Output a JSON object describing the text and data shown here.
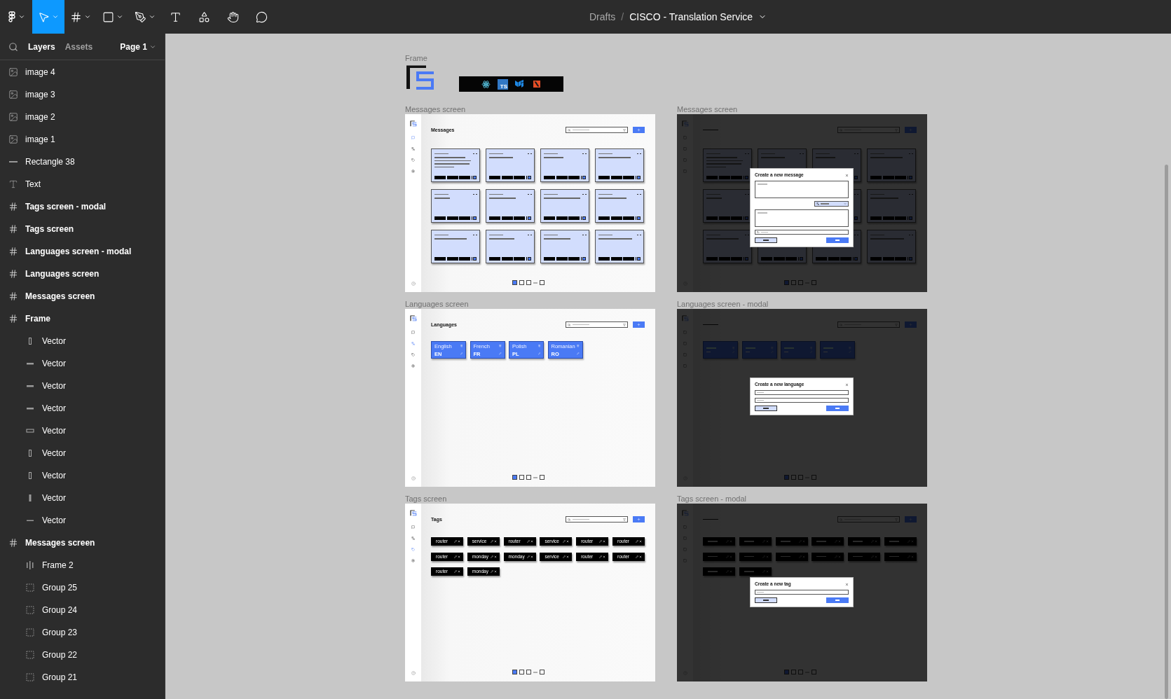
{
  "toolbar": {
    "tools": [
      {
        "kind": "main-menu",
        "selected": false
      },
      {
        "kind": "move",
        "selected": true
      },
      {
        "kind": "frame",
        "selected": false
      },
      {
        "kind": "shape",
        "selected": false
      },
      {
        "kind": "pen",
        "selected": false
      },
      {
        "kind": "text",
        "selected": false
      },
      {
        "kind": "resources",
        "selected": false
      },
      {
        "kind": "hand",
        "selected": false
      },
      {
        "kind": "comment",
        "selected": false
      }
    ]
  },
  "breadcrumb": {
    "folder": "Drafts",
    "separator": "/",
    "file": "CISCO - Translation Service"
  },
  "layers_panel": {
    "tabs": [
      {
        "label": "Layers",
        "selected": true
      },
      {
        "label": "Assets",
        "selected": false
      }
    ],
    "page": "Page 1",
    "items": [
      {
        "kind": "image",
        "name": "image 4"
      },
      {
        "kind": "image",
        "name": "image 3"
      },
      {
        "kind": "image",
        "name": "image 2"
      },
      {
        "kind": "image",
        "name": "image 1"
      },
      {
        "kind": "line",
        "name": "Rectangle 38"
      },
      {
        "kind": "text",
        "name": "Text"
      },
      {
        "kind": "frame",
        "name": "Tags screen - modal"
      },
      {
        "kind": "frame",
        "name": "Tags screen"
      },
      {
        "kind": "frame",
        "name": "Languages screen - modal"
      },
      {
        "kind": "frame",
        "name": "Languages screen"
      },
      {
        "kind": "frame",
        "name": "Messages screen"
      },
      {
        "kind": "frame",
        "name": "Frame",
        "children": [
          {
            "kind": "vector-vertical",
            "name": "Vector"
          },
          {
            "kind": "vector-horizontal",
            "name": "Vector"
          },
          {
            "kind": "vector-horizontal",
            "name": "Vector"
          },
          {
            "kind": "vector-horizontal",
            "name": "Vector"
          },
          {
            "kind": "vector-rect",
            "name": "Vector"
          },
          {
            "kind": "vector-vertical",
            "name": "Vector"
          },
          {
            "kind": "vector-vertical",
            "name": "Vector"
          },
          {
            "kind": "vector-bar",
            "name": "Vector"
          },
          {
            "kind": "vector-line",
            "name": "Vector"
          }
        ]
      },
      {
        "kind": "frame",
        "name": "Messages screen",
        "children": [
          {
            "kind": "columns",
            "name": "Frame 2"
          },
          {
            "kind": "group",
            "name": "Group 25"
          },
          {
            "kind": "group",
            "name": "Group 24"
          },
          {
            "kind": "group",
            "name": "Group 23"
          },
          {
            "kind": "group",
            "name": "Group 22"
          },
          {
            "kind": "group",
            "name": "Group 21"
          }
        ]
      }
    ]
  },
  "canvas": {
    "frame_label": "Frame",
    "banner_badge": "TS",
    "screens": [
      {
        "label": "Messages screen",
        "kind": "messages",
        "title": "Messages",
        "nav": [
          {
            "kind": "messages",
            "selected": true
          },
          {
            "kind": "languages",
            "selected": false
          },
          {
            "kind": "tags",
            "selected": false
          },
          {
            "kind": "settings",
            "selected": false
          }
        ],
        "pages": [
          {
            "kind": "page",
            "selected": true
          },
          {
            "kind": "page",
            "selected": false
          },
          {
            "kind": "page",
            "selected": false
          },
          {
            "kind": "ellipsis"
          },
          {
            "kind": "page",
            "selected": false
          }
        ]
      },
      {
        "label": "Messages screen",
        "kind": "messages",
        "modal": {
          "kind": "message",
          "title": "Create a new message",
          "fields": [
            {
              "kind": "textarea"
            },
            {
              "kind": "select"
            },
            {
              "kind": "textarea"
            },
            {
              "kind": "tags"
            }
          ]
        }
      },
      {
        "label": "Languages screen",
        "kind": "languages",
        "title": "Languages",
        "nav": [
          {
            "kind": "messages",
            "selected": false
          },
          {
            "kind": "languages",
            "selected": true
          },
          {
            "kind": "tags",
            "selected": false
          },
          {
            "kind": "settings",
            "selected": false
          }
        ],
        "languages": [
          {
            "name": "English",
            "code": "EN"
          },
          {
            "name": "French",
            "code": "FR"
          },
          {
            "name": "Polish",
            "code": "PL"
          },
          {
            "name": "Romanian",
            "code": "RO"
          }
        ],
        "pages": [
          {
            "kind": "page",
            "selected": true
          },
          {
            "kind": "page",
            "selected": false
          },
          {
            "kind": "page",
            "selected": false
          },
          {
            "kind": "ellipsis"
          },
          {
            "kind": "page",
            "selected": false
          }
        ]
      },
      {
        "label": "Languages screen - modal",
        "kind": "languages",
        "modal": {
          "kind": "language",
          "title": "Create a new language",
          "fields": [
            {
              "kind": "input"
            },
            {
              "kind": "input"
            }
          ]
        }
      },
      {
        "label": "Tags screen",
        "kind": "tags",
        "title": "Tags",
        "nav": [
          {
            "kind": "messages",
            "selected": false
          },
          {
            "kind": "languages",
            "selected": false
          },
          {
            "kind": "tags",
            "selected": true
          },
          {
            "kind": "settings",
            "selected": false
          }
        ],
        "tags": [
          "router",
          "service",
          "router",
          "service",
          "router",
          "router",
          "router",
          "monday",
          "monday",
          "service",
          "router",
          "router",
          "router",
          "monday"
        ],
        "pages": [
          {
            "kind": "page",
            "selected": true
          },
          {
            "kind": "page",
            "selected": false
          },
          {
            "kind": "page",
            "selected": false
          },
          {
            "kind": "ellipsis"
          },
          {
            "kind": "page",
            "selected": false
          }
        ]
      },
      {
        "label": "Tags screen - modal",
        "kind": "tags",
        "modal": {
          "kind": "tag",
          "title": "Create a new tag",
          "fields": [
            {
              "kind": "input"
            }
          ]
        }
      }
    ]
  }
}
